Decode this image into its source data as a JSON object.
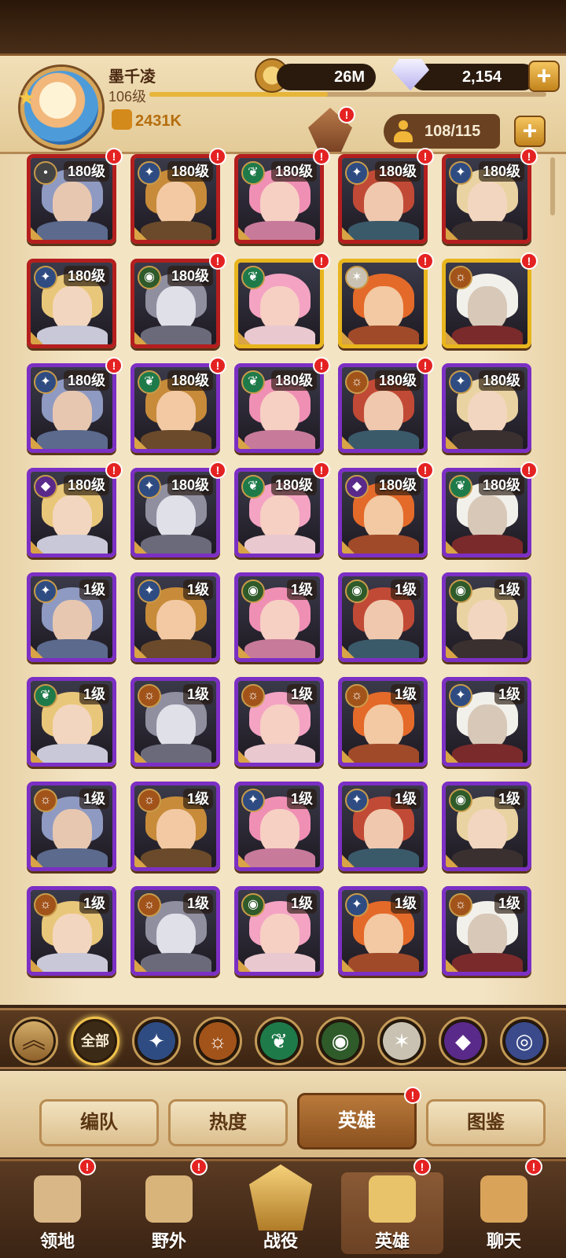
{
  "player": {
    "name": "墨千凌",
    "level": "106级",
    "power": "2431K",
    "exp_fraction": 0.45
  },
  "currency": {
    "gold": "26M",
    "gems": "2,154"
  },
  "roster": {
    "count": "108/115"
  },
  "colors": {
    "accent": "#d4a03c",
    "panel": "#f3e4c4",
    "ascended_border": "#b41e1e",
    "legendary_border": "#e8b51d",
    "elite_border": "#7c2fc4",
    "badge_red": "#e52222"
  },
  "heroes": [
    {
      "level": "180级",
      "faction": "forest-icon",
      "tier": "ascended",
      "badge": true
    },
    {
      "level": "180级",
      "faction": "lightbearer-icon",
      "tier": "ascended",
      "badge": true
    },
    {
      "level": "180级",
      "faction": "wilder-icon",
      "tier": "ascended",
      "badge": true
    },
    {
      "level": "180级",
      "faction": "lightbearer-icon",
      "tier": "ascended",
      "badge": true
    },
    {
      "level": "180级",
      "faction": "lightbearer-icon",
      "tier": "ascended",
      "badge": true
    },
    {
      "level": "180级",
      "faction": "lightbearer-icon",
      "tier": "ascended",
      "badge": false
    },
    {
      "level": "180级",
      "faction": "graveborn-icon",
      "tier": "ascended",
      "badge": true
    },
    {
      "level": "",
      "faction": "wilder-icon",
      "tier": "legendary",
      "badge": true
    },
    {
      "level": "",
      "faction": "celestial-icon",
      "tier": "legendary",
      "badge": true
    },
    {
      "level": "",
      "faction": "mauler-icon",
      "tier": "legendary",
      "badge": true
    },
    {
      "level": "180级",
      "faction": "lightbearer-icon",
      "tier": "elite",
      "badge": true
    },
    {
      "level": "180级",
      "faction": "wilder-icon",
      "tier": "elite",
      "badge": true
    },
    {
      "level": "180级",
      "faction": "wilder-icon",
      "tier": "elite",
      "badge": true
    },
    {
      "level": "180级",
      "faction": "mauler-icon",
      "tier": "elite",
      "badge": true
    },
    {
      "level": "180级",
      "faction": "lightbearer-icon",
      "tier": "elite",
      "badge": false
    },
    {
      "level": "180级",
      "faction": "hypogean-icon",
      "tier": "elite",
      "badge": true
    },
    {
      "level": "180级",
      "faction": "lightbearer-icon",
      "tier": "elite",
      "badge": true
    },
    {
      "level": "180级",
      "faction": "wilder-icon",
      "tier": "elite",
      "badge": true
    },
    {
      "level": "180级",
      "faction": "hypogean-icon",
      "tier": "elite",
      "badge": true
    },
    {
      "level": "180级",
      "faction": "wilder-icon",
      "tier": "elite",
      "badge": true
    },
    {
      "level": "1级",
      "faction": "lightbearer-icon",
      "tier": "elite",
      "badge": false
    },
    {
      "level": "1级",
      "faction": "lightbearer-icon",
      "tier": "elite",
      "badge": false
    },
    {
      "level": "1级",
      "faction": "graveborn-icon",
      "tier": "elite",
      "badge": false
    },
    {
      "level": "1级",
      "faction": "graveborn-icon",
      "tier": "elite",
      "badge": false
    },
    {
      "level": "1级",
      "faction": "graveborn-icon",
      "tier": "elite",
      "badge": false
    },
    {
      "level": "1级",
      "faction": "wilder-icon",
      "tier": "elite",
      "badge": false
    },
    {
      "level": "1级",
      "faction": "mauler-icon",
      "tier": "elite",
      "badge": false
    },
    {
      "level": "1级",
      "faction": "mauler-icon",
      "tier": "elite",
      "badge": false
    },
    {
      "level": "1级",
      "faction": "mauler-icon",
      "tier": "elite",
      "badge": false
    },
    {
      "level": "1级",
      "faction": "lightbearer-icon",
      "tier": "elite",
      "badge": false
    },
    {
      "level": "1级",
      "faction": "mauler-icon",
      "tier": "elite",
      "badge": false
    },
    {
      "level": "1级",
      "faction": "mauler-icon",
      "tier": "elite",
      "badge": false
    },
    {
      "level": "1级",
      "faction": "lightbearer-icon",
      "tier": "elite",
      "badge": false
    },
    {
      "level": "1级",
      "faction": "lightbearer-icon",
      "tier": "elite",
      "badge": false
    },
    {
      "level": "1级",
      "faction": "graveborn-icon",
      "tier": "elite",
      "badge": false
    },
    {
      "level": "1级",
      "faction": "mauler-icon",
      "tier": "elite",
      "badge": false
    },
    {
      "level": "1级",
      "faction": "mauler-icon",
      "tier": "elite",
      "badge": false
    },
    {
      "level": "1级",
      "faction": "graveborn-icon",
      "tier": "elite",
      "badge": false
    },
    {
      "level": "1级",
      "faction": "lightbearer-icon",
      "tier": "elite",
      "badge": false
    },
    {
      "level": "1级",
      "faction": "mauler-icon",
      "tier": "elite",
      "badge": false
    }
  ],
  "filters": {
    "all_label": "全部",
    "items": [
      "lightbearer-icon",
      "mauler-icon",
      "wilder-icon",
      "graveborn-icon",
      "celestial-icon",
      "hypogean-icon",
      "dimensional-icon"
    ]
  },
  "subtabs": [
    {
      "label": "编队",
      "active": false,
      "badge": false
    },
    {
      "label": "热度",
      "active": false,
      "badge": false
    },
    {
      "label": "英雄",
      "active": true,
      "badge": true
    },
    {
      "label": "图鉴",
      "active": false,
      "badge": false
    }
  ],
  "nav": [
    {
      "label": "领地",
      "icon": "castle-icon",
      "badge": true,
      "active": false
    },
    {
      "label": "野外",
      "icon": "map-scroll-icon",
      "badge": true,
      "active": false
    },
    {
      "label": "战役",
      "icon": "campaign-crest-icon",
      "badge": false,
      "active": false
    },
    {
      "label": "英雄",
      "icon": "helmet-icon",
      "badge": true,
      "active": true
    },
    {
      "label": "聊天",
      "icon": "chat-bubble-icon",
      "badge": true,
      "active": false
    }
  ]
}
